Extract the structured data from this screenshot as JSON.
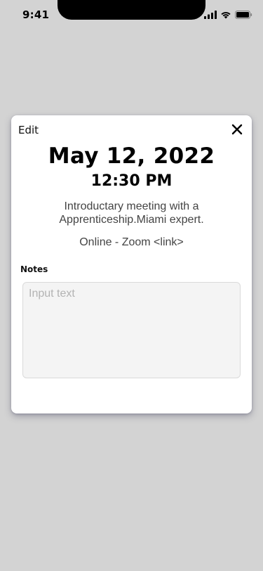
{
  "status_bar": {
    "time": "9:41",
    "icons": [
      "cellular-signal-icon",
      "wifi-icon",
      "battery-icon"
    ]
  },
  "modal": {
    "edit_label": "Edit",
    "close_icon": "close-icon",
    "date": "May 12, 2022",
    "time": "12:30 PM",
    "description": "Introductary meeting with a Apprenticeship.Miami expert.",
    "location": "Online - Zoom <link>",
    "notes_label": "Notes",
    "notes_value": "",
    "notes_placeholder": "Input text"
  },
  "colors": {
    "background": "#d3d3d3",
    "card": "#ffffff",
    "input_background": "#f4f4f4",
    "secondary_text": "#444444",
    "placeholder": "#b3b3b3"
  }
}
